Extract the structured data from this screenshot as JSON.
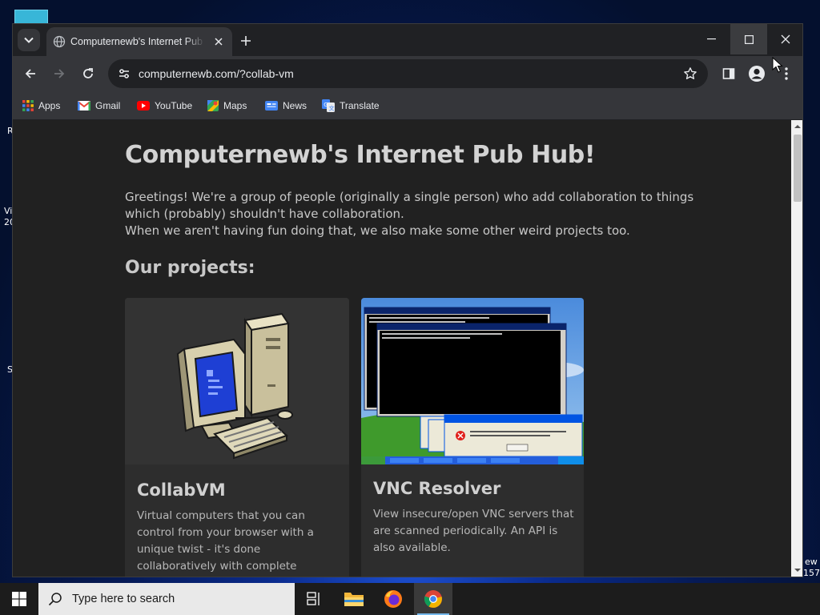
{
  "browser": {
    "tab": {
      "title": "Computernewb's Internet Pub Hub!"
    },
    "address": {
      "url": "computernewb.com/?collab-vm"
    },
    "bookmarks": [
      {
        "label": "Apps",
        "icon": "apps-grid-icon"
      },
      {
        "label": "Gmail",
        "icon": "gmail-icon"
      },
      {
        "label": "YouTube",
        "icon": "youtube-icon"
      },
      {
        "label": "Maps",
        "icon": "maps-icon"
      },
      {
        "label": "News",
        "icon": "news-icon"
      },
      {
        "label": "Translate",
        "icon": "translate-icon"
      }
    ]
  },
  "page": {
    "title": "Computernewb's Internet Pub Hub!",
    "intro": [
      "Greetings! We're a group of people (originally a single person) who add collaboration to things",
      "which (probably) shouldn't have collaboration.",
      "When we aren't having fun doing that, we also make some other weird projects too."
    ],
    "section_title": "Our projects:",
    "projects": [
      {
        "title": "CollabVM",
        "description": "Virtual computers that you can control from your browser with a unique twist - it's done collaboratively with complete strangers."
      },
      {
        "title": "VNC Resolver",
        "description": "View insecure/open VNC servers that are scanned periodically. An API is also available."
      }
    ]
  },
  "desktop": {
    "edge_fragments": [
      "R",
      "Vi",
      "20",
      "S",
      "ew",
      "157"
    ]
  },
  "taskbar": {
    "search_placeholder": "Type here to search",
    "apps": [
      "task-view",
      "file-explorer",
      "firefox",
      "chrome"
    ]
  },
  "colors": {
    "page_bg": "#212121",
    "card_bg": "#2d2d2d",
    "chrome_dark": "#202124",
    "chrome_toolbar": "#35363a",
    "taskbar": "#1c1c1c"
  }
}
